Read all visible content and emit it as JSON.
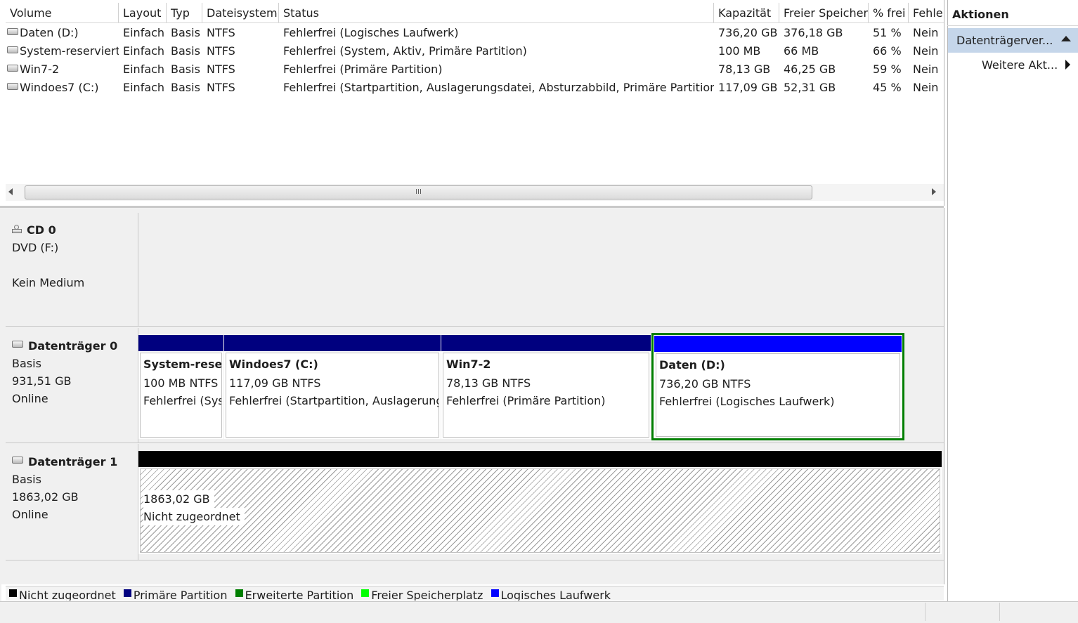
{
  "volume_list": {
    "columns": [
      "Volume",
      "Layout",
      "Typ",
      "Dateisystem",
      "Status",
      "Kapazität",
      "Freier Speicher",
      "% frei",
      "Fehler"
    ],
    "rows": [
      [
        "Daten (D:)",
        "Einfach",
        "Basis",
        "NTFS",
        "Fehlerfrei (Logisches Laufwerk)",
        "736,20 GB",
        "376,18 GB",
        "51 %",
        "Nein"
      ],
      [
        "System-reserviert",
        "Einfach",
        "Basis",
        "NTFS",
        "Fehlerfrei (System, Aktiv, Primäre Partition)",
        "100 MB",
        "66 MB",
        "66 %",
        "Nein"
      ],
      [
        "Win7-2",
        "Einfach",
        "Basis",
        "NTFS",
        "Fehlerfrei (Primäre Partition)",
        "78,13 GB",
        "46,25 GB",
        "59 %",
        "Nein"
      ],
      [
        "Windoes7 (C:)",
        "Einfach",
        "Basis",
        "NTFS",
        "Fehlerfrei (Startpartition, Auslagerungsdatei, Absturzabbild, Primäre Partition)",
        "117,09 GB",
        "52,31 GB",
        "45 %",
        "Nein"
      ]
    ],
    "scroll_grip": "III"
  },
  "disks": {
    "cd0": {
      "title": "CD 0",
      "line1": "DVD (F:)",
      "line2": "",
      "line3": "Kein Medium"
    },
    "disk0": {
      "title": "Datenträger 0",
      "line1": "Basis",
      "line2": "931,51 GB",
      "line3": "Online",
      "partitions": [
        {
          "title": "System-reserviert",
          "line1": "100 MB NTFS",
          "line2": "Fehlerfrei (System, Aktiv, Primäre Partition)"
        },
        {
          "title": "Windoes7  (C:)",
          "line1": "117,09 GB NTFS",
          "line2": "Fehlerfrei (Startpartition, Auslagerungsdatei, Absturzabbild, Primäre Partition)"
        },
        {
          "title": "Win7-2",
          "line1": "78,13 GB NTFS",
          "line2": "Fehlerfrei (Primäre Partition)"
        },
        {
          "title": "Daten  (D:)",
          "line1": "736,20 GB NTFS",
          "line2": "Fehlerfrei (Logisches Laufwerk)"
        }
      ]
    },
    "disk1": {
      "title": "Datenträger 1",
      "line1": "Basis",
      "line2": "1863,02 GB",
      "line3": "Online",
      "unallocated": {
        "line1": "1863,02 GB",
        "line2": "Nicht zugeordnet"
      }
    }
  },
  "legend": [
    {
      "label": "Nicht zugeordnet",
      "color": "#000000"
    },
    {
      "label": "Primäre Partition",
      "color": "#00007f"
    },
    {
      "label": "Erweiterte Partition",
      "color": "#007f00"
    },
    {
      "label": "Freier Speicherplatz",
      "color": "#00ff00"
    },
    {
      "label": "Logisches Laufwerk",
      "color": "#0000ff"
    }
  ],
  "actions": {
    "title": "Aktionen",
    "section": "Datenträgerver...",
    "more": "Weitere Akt..."
  },
  "colors": {
    "primary": "#00007f",
    "logical": "#0000ff",
    "unallocated": "#000000",
    "selected_border": "#007f00",
    "action_highlight": "#c5d6ea"
  }
}
